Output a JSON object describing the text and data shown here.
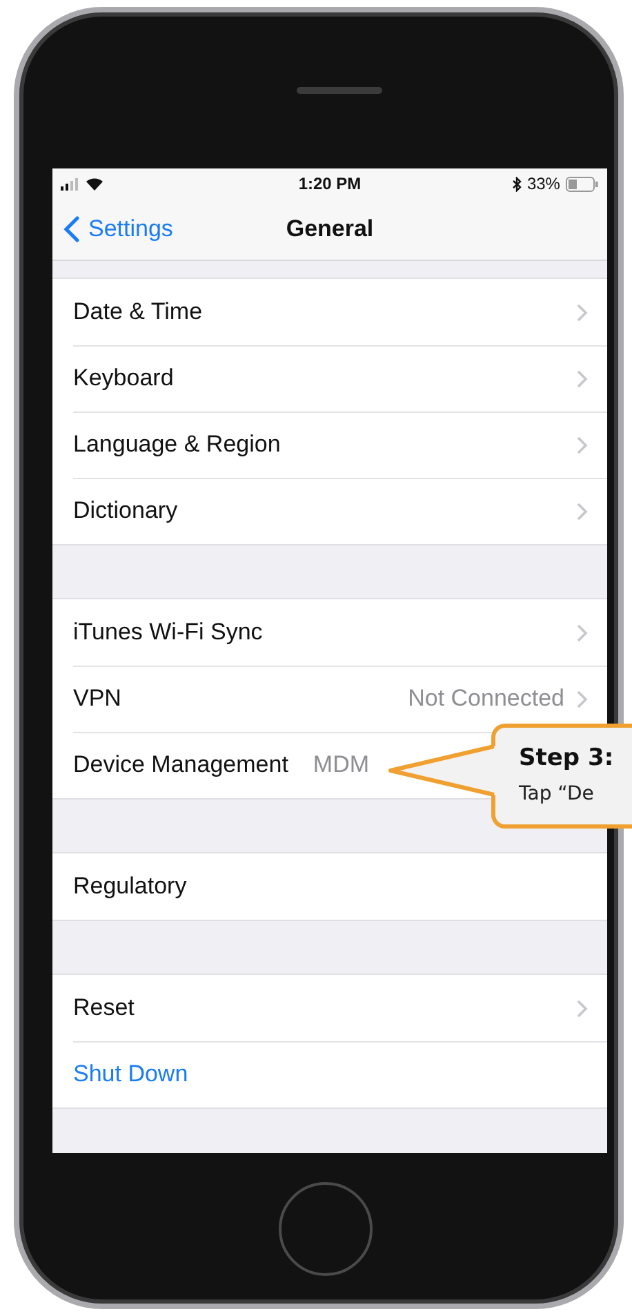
{
  "status_bar": {
    "time": "1:20 PM",
    "battery": "33%"
  },
  "nav": {
    "back": "Settings",
    "title": "General"
  },
  "groups": [
    {
      "rows": [
        {
          "kind": "nav",
          "label": "Date & Time",
          "chevron": true
        },
        {
          "kind": "nav",
          "label": "Keyboard",
          "chevron": true
        },
        {
          "kind": "nav",
          "label": "Language & Region",
          "chevron": true
        },
        {
          "kind": "nav",
          "label": "Dictionary",
          "chevron": true
        }
      ]
    },
    {
      "rows": [
        {
          "kind": "nav",
          "label": "iTunes Wi-Fi Sync",
          "chevron": true
        },
        {
          "kind": "nav",
          "label": "VPN",
          "value": "Not Connected",
          "chevron": true
        },
        {
          "kind": "nav",
          "label": "Device Management",
          "value": "MDM",
          "chevron": false
        }
      ]
    },
    {
      "rows": [
        {
          "kind": "nav",
          "label": "Regulatory",
          "chevron": false
        }
      ]
    },
    {
      "rows": [
        {
          "kind": "nav",
          "label": "Reset",
          "chevron": true
        },
        {
          "kind": "action",
          "label": "Shut Down",
          "chevron": false
        }
      ]
    }
  ],
  "callout": {
    "title": "Step 3:",
    "text": "Tap “De"
  }
}
